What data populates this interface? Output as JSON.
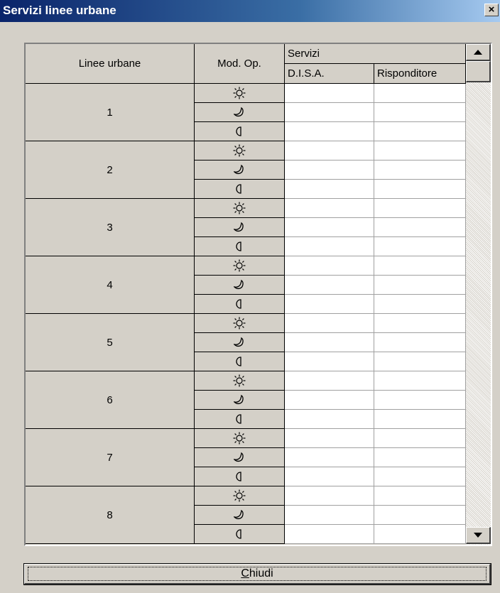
{
  "window": {
    "title": "Servizi linee urbane",
    "close_glyph": "×"
  },
  "grid": {
    "header": {
      "lines_label": "Linee urbane",
      "mode_label": "Mod. Op.",
      "services_label": "Servizi",
      "disa_label": "D.I.S.A.",
      "responder_label": "Risponditore"
    },
    "lines": [
      {
        "number": "1"
      },
      {
        "number": "2"
      },
      {
        "number": "3"
      },
      {
        "number": "4"
      },
      {
        "number": "5"
      },
      {
        "number": "6"
      },
      {
        "number": "7"
      },
      {
        "number": "8"
      }
    ],
    "modes": [
      "sun-icon",
      "moon-icon",
      "half-moon-icon"
    ]
  },
  "buttons": {
    "close_underlined": "C",
    "close_rest": "hiudi"
  }
}
